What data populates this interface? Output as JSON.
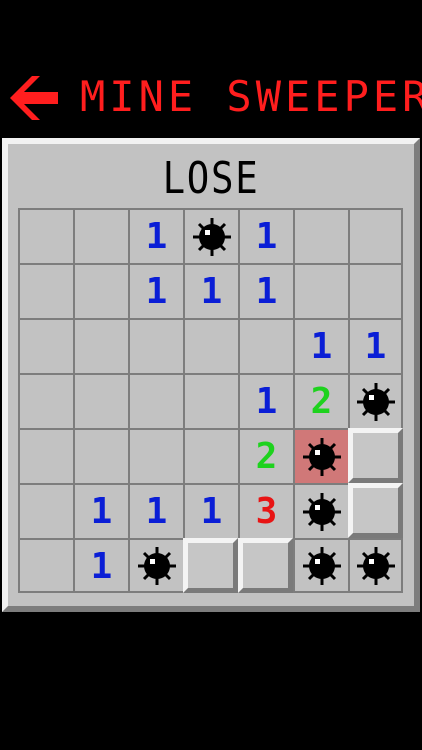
{
  "header": {
    "title": "MINE SWEEPER",
    "back_icon": "left-arrow-icon",
    "title_color": "#ff1e1e"
  },
  "game": {
    "status": "LOSE",
    "rows": 7,
    "cols": 7,
    "colors": {
      "1": "#0a1ed6",
      "2": "#1ed21e",
      "3": "#e81414"
    },
    "grid": [
      [
        "",
        "",
        "1",
        "M",
        "1",
        "",
        ""
      ],
      [
        "",
        "",
        "1",
        "1",
        "1",
        "",
        ""
      ],
      [
        "",
        "",
        "",
        "",
        "",
        "1",
        "1"
      ],
      [
        "",
        "",
        "",
        "",
        "1",
        "2",
        "M"
      ],
      [
        "",
        "",
        "",
        "",
        "2",
        "X",
        "C"
      ],
      [
        "",
        "1",
        "1",
        "1",
        "3",
        "M",
        "C"
      ],
      [
        "",
        "1",
        "M",
        "C",
        "C",
        "M",
        "M"
      ]
    ]
  }
}
